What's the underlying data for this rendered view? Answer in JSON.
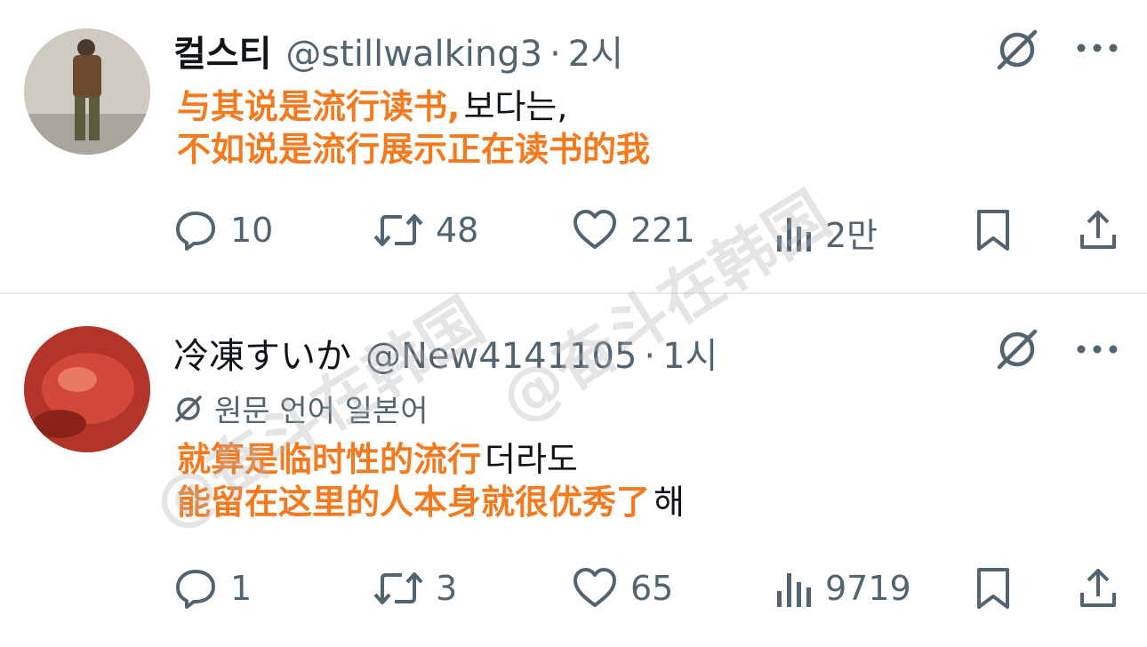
{
  "tweets": [
    {
      "display_name": "컬스티",
      "handle": "@stillwalking3",
      "separator": "·",
      "time": "2시",
      "body_lines": [
        "보다는,"
      ],
      "body_line2_tail": "",
      "overlay_lines": [
        "与其说是流行读书,",
        "不如说是流行展示正在读书的我"
      ],
      "stats": {
        "replies": "10",
        "retweets": "48",
        "likes": "221",
        "views": "2만"
      }
    },
    {
      "display_name": "冷凍すいか",
      "handle": "@New4141105",
      "separator": "·",
      "time": "1시",
      "translate_label": "원문 언어 일본어",
      "body_lines": [
        "더라도",
        "해"
      ],
      "overlay_lines": [
        "就算是临时性的流行",
        "能留在这里的人本身就很优秀了"
      ],
      "stats": {
        "replies": "1",
        "retweets": "3",
        "likes": "65",
        "views": "9719"
      }
    }
  ],
  "watermark": "@奋斗在韩国",
  "colors": {
    "text": "#0f1419",
    "secondary": "#536471",
    "overlay": "#f47a20",
    "divider": "#e8eaed"
  },
  "icons": [
    "grok-icon",
    "more-icon",
    "reply-icon",
    "retweet-icon",
    "like-icon",
    "views-icon",
    "bookmark-icon",
    "share-icon",
    "translate-icon"
  ]
}
